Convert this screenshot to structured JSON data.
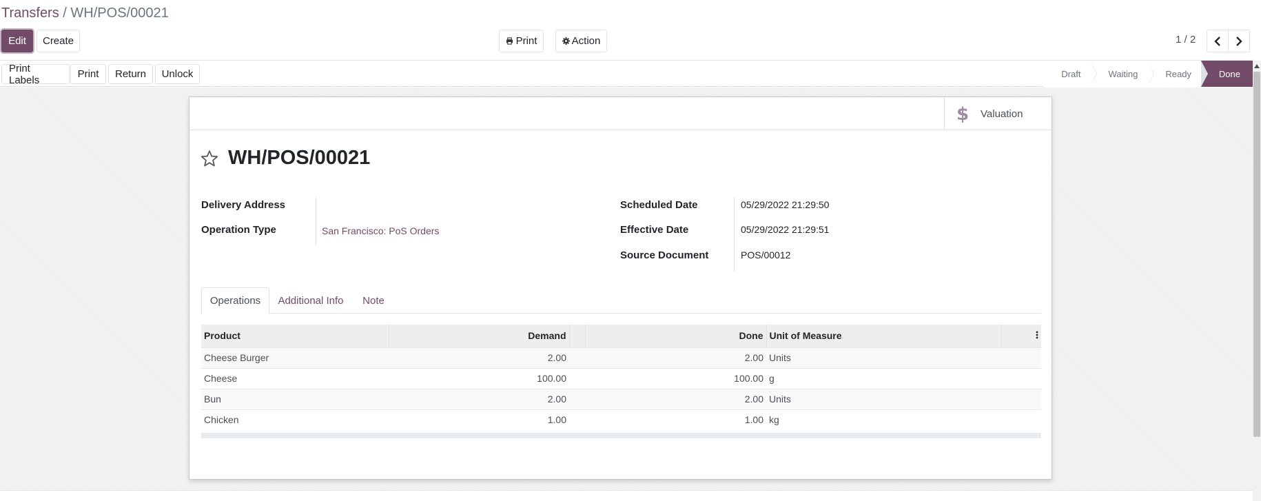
{
  "breadcrumb": {
    "parent": "Transfers",
    "separator": "/",
    "current": "WH/POS/00021"
  },
  "toolbar": {
    "edit_label": "Edit",
    "create_label": "Create",
    "print_label": "Print",
    "action_label": "Action"
  },
  "pager": {
    "value": "1 / 2"
  },
  "header_buttons": {
    "print_labels": "Print Labels",
    "print": "Print",
    "return": "Return",
    "unlock": "Unlock"
  },
  "statusbar": {
    "steps": [
      "Draft",
      "Waiting",
      "Ready",
      "Done"
    ],
    "active": "Done"
  },
  "button_box": {
    "valuation_label": "Valuation"
  },
  "record": {
    "title": "WH/POS/00021",
    "delivery_address_label": "Delivery Address",
    "delivery_address_value": "",
    "operation_type_label": "Operation Type",
    "operation_type_value": "San Francisco: PoS Orders",
    "scheduled_date_label": "Scheduled Date",
    "scheduled_date_value": "05/29/2022 21:29:50",
    "effective_date_label": "Effective Date",
    "effective_date_value": "05/29/2022 21:29:51",
    "source_document_label": "Source Document",
    "source_document_value": "POS/00012"
  },
  "tabs": [
    {
      "label": "Operations",
      "active": true
    },
    {
      "label": "Additional Info",
      "active": false
    },
    {
      "label": "Note",
      "active": false
    }
  ],
  "table": {
    "headers": {
      "product": "Product",
      "demand": "Demand",
      "done": "Done",
      "uom": "Unit of Measure"
    },
    "rows": [
      {
        "product": "Cheese Burger",
        "demand": "2.00",
        "done": "2.00",
        "uom": "Units"
      },
      {
        "product": "Cheese",
        "demand": "100.00",
        "done": "100.00",
        "uom": "g"
      },
      {
        "product": "Bun",
        "demand": "2.00",
        "done": "2.00",
        "uom": "Units"
      },
      {
        "product": "Chicken",
        "demand": "1.00",
        "done": "1.00",
        "uom": "kg"
      }
    ]
  },
  "colors": {
    "brand": "#714B67",
    "border": "#dee2e6"
  }
}
